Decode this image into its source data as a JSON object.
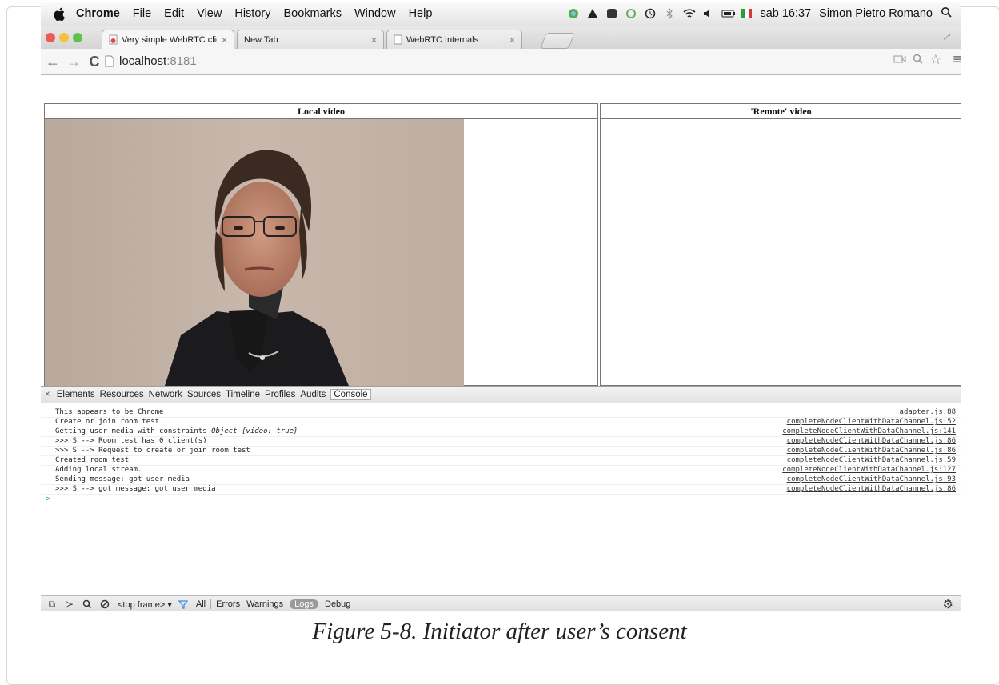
{
  "menubar": {
    "app": "Chrome",
    "menus": [
      "File",
      "Edit",
      "View",
      "History",
      "Bookmarks",
      "Window",
      "Help"
    ],
    "clock": "sab 16:37",
    "user": "Simon Pietro Romano"
  },
  "tabs": [
    {
      "label": "Very simple WebRTC client",
      "close": "×"
    },
    {
      "label": "New Tab",
      "close": "×"
    },
    {
      "label": "WebRTC Internals",
      "close": "×"
    }
  ],
  "address": {
    "host": "localhost",
    "port": ":8181"
  },
  "page": {
    "local_header": "Local video",
    "remote_header": "'Remote' video"
  },
  "devtools": {
    "tabs": [
      "Elements",
      "Resources",
      "Network",
      "Sources",
      "Timeline",
      "Profiles",
      "Audits",
      "Console"
    ],
    "active_tab": "Console",
    "console_rows": [
      {
        "pre": "This appears to be Chrome",
        "em": "",
        "post": "",
        "src": "adapter.js:88"
      },
      {
        "pre": "Create or join room test",
        "em": "",
        "post": "",
        "src": "completeNodeClientWithDataChannel.js:52"
      },
      {
        "pre": "Getting user media with constraints ",
        "em": "Object {video: true}",
        "post": "",
        "src": "completeNodeClientWithDataChannel.js:141"
      },
      {
        "pre": ">>>  S --> Room test has 0 client(s)",
        "em": "",
        "post": "",
        "src": "completeNodeClientWithDataChannel.js:86"
      },
      {
        "pre": ">>>  S --> Request to create or join room test",
        "em": "",
        "post": "",
        "src": "completeNodeClientWithDataChannel.js:86"
      },
      {
        "pre": "Created room test",
        "em": "",
        "post": "",
        "src": "completeNodeClientWithDataChannel.js:59"
      },
      {
        "pre": "Adding local stream.",
        "em": "",
        "post": "",
        "src": "completeNodeClientWithDataChannel.js:127"
      },
      {
        "pre": "Sending message:  got user media",
        "em": "",
        "post": "",
        "src": "completeNodeClientWithDataChannel.js:93"
      },
      {
        "pre": ">>>  S --> got message:  got user media",
        "em": "",
        "post": "",
        "src": "completeNodeClientWithDataChannel.js:86"
      }
    ],
    "prompt": ">",
    "status": {
      "frame": "<top frame> ▾",
      "filters": [
        "All",
        "Errors",
        "Warnings",
        "Logs",
        "Debug"
      ],
      "active_filter": "Logs"
    }
  },
  "caption": "Figure 5-8. Initiator after user’s consent",
  "colors": {
    "close": "#ee5a52",
    "minimize": "#f5bf40",
    "zoom": "#5ec24a",
    "favicon": "#e44"
  }
}
